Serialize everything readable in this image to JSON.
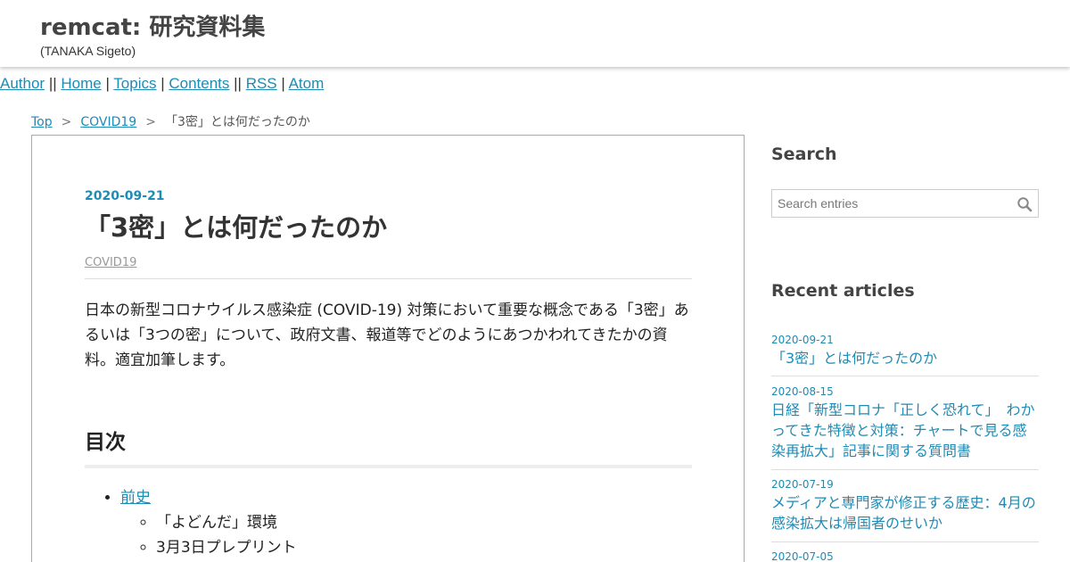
{
  "header": {
    "title": "remcat: 研究資料集",
    "subtitle": "(TANAKA Sigeto)"
  },
  "nav": {
    "author": "Author",
    "home": "Home",
    "topics": "Topics",
    "contents": "Contents",
    "rss": "RSS",
    "atom": "Atom",
    "sep_double": " || ",
    "sep_single": " | "
  },
  "breadcrumb": {
    "top": "Top",
    "category": "COVID19",
    "current": "「3密」とは何だったのか",
    "separator": ">"
  },
  "entry": {
    "date": "2020-09-21",
    "title": "「3密」とは何だったのか",
    "category": "COVID19",
    "body": "日本の新型コロナウイルス感染症 (COVID-19) 対策において重要な概念である「3密」あるいは「3つの密」について、政府文書、報道等でどのようにあつかわれてきたかの資料。適宜加筆します。",
    "toc_title": "目次",
    "toc": [
      {
        "label": "前史",
        "children": [
          "「よどんだ」環境",
          "3月3日プレプリント"
        ]
      }
    ]
  },
  "sidebar": {
    "search_heading": "Search",
    "search_placeholder": "Search entries",
    "recent_heading": "Recent articles",
    "recent": [
      {
        "date": "2020-09-21",
        "title": "「3密」とは何だったのか"
      },
      {
        "date": "2020-08-15",
        "title": "日経「新型コロナ「正しく恐れて」　わかってきた特徴と対策：チャートで見る感染再拡大」記事に関する質問書"
      },
      {
        "date": "2020-07-19",
        "title": "メディアと専門家が修正する歴史：4月の感染拡大は帰国者のせいか"
      },
      {
        "date": "2020-07-05",
        "title": ""
      }
    ]
  },
  "colors": {
    "link": "#1e8bb4",
    "text": "#333333",
    "border": "#aaaaaa"
  },
  "icons": {
    "search": "magnifier-icon"
  }
}
